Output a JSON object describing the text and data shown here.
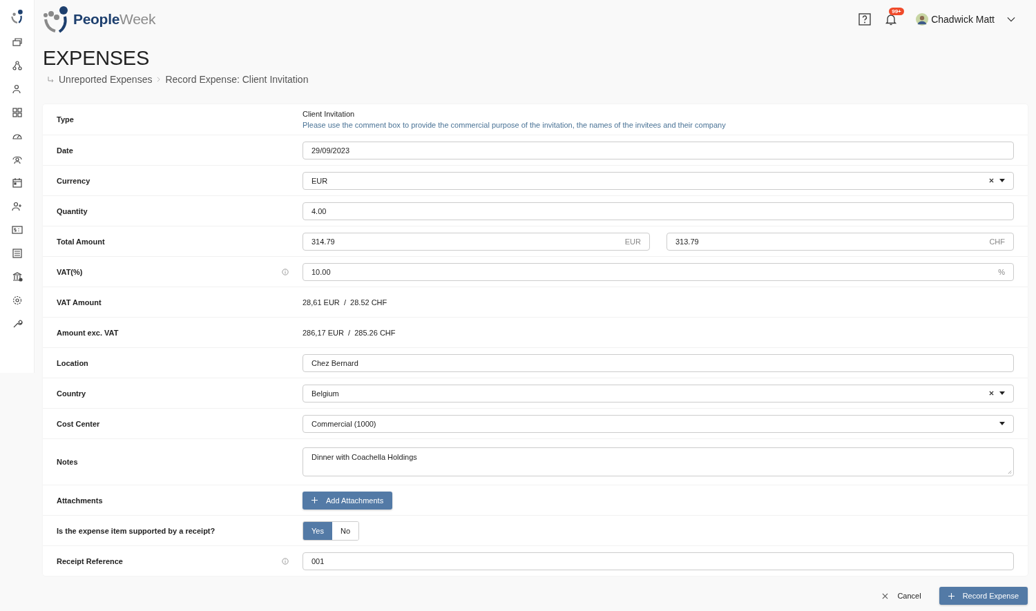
{
  "logo": {
    "parts": [
      "People",
      "Week"
    ]
  },
  "header": {
    "notifications": "99+",
    "user": "Chadwick Matt"
  },
  "page": {
    "title": "EXPENSES",
    "breadcrumb": [
      "Unreported Expenses",
      "Record Expense: Client Invitation"
    ]
  },
  "form": {
    "rows": [
      {
        "label": "Type",
        "kind": "info",
        "value": "Client Invitation",
        "hint": "Please use the comment box to provide the commercial purpose of the invitation, the names of the invitees and their company"
      },
      {
        "label": "Date",
        "kind": "input",
        "value": "29/09/2023"
      },
      {
        "label": "Currency",
        "kind": "select",
        "value": "EUR",
        "clearable": true
      },
      {
        "label": "Quantity",
        "kind": "input",
        "value": "4.00"
      },
      {
        "label": "Total Amount",
        "kind": "dual",
        "inputs": [
          {
            "value": "314.79",
            "suffix": "EUR"
          },
          {
            "value": "313.79",
            "suffix": "CHF"
          }
        ]
      },
      {
        "label": "VAT(%)",
        "kind": "input",
        "value": "10.00",
        "suffix": "%",
        "info": true
      },
      {
        "label": "VAT Amount",
        "kind": "readout",
        "value": "28,61 EUR  /  28.52 CHF"
      },
      {
        "label": "Amount exc. VAT",
        "kind": "readout",
        "value": "286,17 EUR  /  285.26 CHF"
      },
      {
        "label": "Location",
        "kind": "input",
        "value": "Chez Bernard"
      },
      {
        "label": "Country",
        "kind": "select",
        "value": "Belgium",
        "clearable": true
      },
      {
        "label": "Cost Center",
        "kind": "select",
        "value": "Commercial (1000)",
        "clearable": false
      },
      {
        "label": "Notes",
        "kind": "textarea",
        "value": "Dinner with Coachella Holdings"
      },
      {
        "label": "Attachments",
        "kind": "button",
        "button": "Add Attachments"
      },
      {
        "label": "Is the expense item supported by a receipt?",
        "kind": "toggle",
        "options": [
          {
            "label": "Yes",
            "selected": true
          },
          {
            "label": "No",
            "selected": false
          }
        ]
      },
      {
        "label": "Receipt Reference",
        "kind": "input",
        "value": "001",
        "info": true
      }
    ]
  },
  "actions": {
    "cancel": "Cancel",
    "submit": "Record Expense"
  }
}
